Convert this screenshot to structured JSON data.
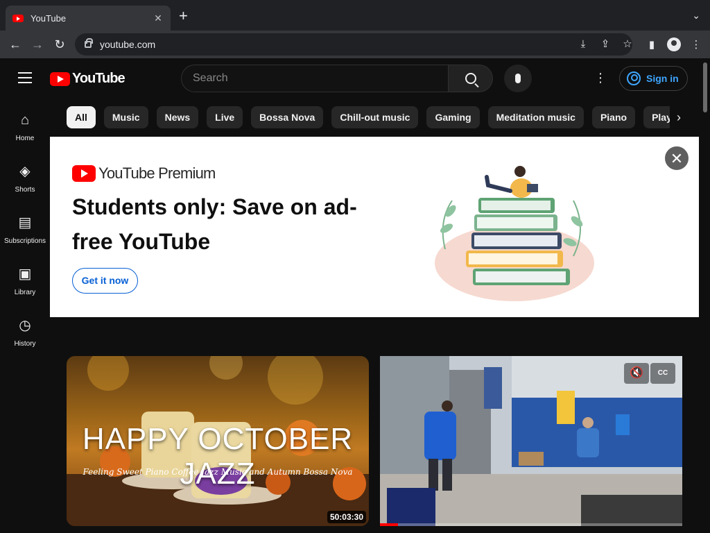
{
  "browser": {
    "tab_title": "YouTube",
    "tab_close": "✕",
    "new_tab": "+",
    "tab_menu": "⌄",
    "url": "youtube.com",
    "back": "←",
    "forward": "→",
    "reload": "↻",
    "actions": [
      "⤓",
      "⇪",
      "☆"
    ],
    "side_panel": "▮",
    "menu": "⋮"
  },
  "header": {
    "logo_text": "YouTube",
    "search_placeholder": "Search",
    "more": "⋮",
    "sign_in": "Sign in"
  },
  "sidebar": {
    "items": [
      {
        "label": "Home",
        "icon": "⌂"
      },
      {
        "label": "Shorts",
        "icon": "◈"
      },
      {
        "label": "Subscriptions",
        "icon": "▤"
      },
      {
        "label": "Library",
        "icon": "▣"
      },
      {
        "label": "History",
        "icon": "◷"
      }
    ]
  },
  "chips": {
    "items": [
      "All",
      "Music",
      "News",
      "Live",
      "Bossa Nova",
      "Chill-out music",
      "Gaming",
      "Meditation music",
      "Piano",
      "Playli"
    ],
    "next": "›"
  },
  "banner": {
    "brand": "YouTube Premium",
    "headline": "Students only: Save on ad-free YouTube",
    "cta": "Get it now",
    "close": "✕"
  },
  "videos": [
    {
      "thumb_title": "HAPPY OCTOBER JAZZ",
      "thumb_subtitle": "Feeling Sweet Piano Coffee Jazz Music and Autumn Bossa Nova",
      "duration": "50:03:30"
    },
    {
      "mute_icon": "🔇",
      "cc_label": "CC",
      "progress_fraction": 0.06
    }
  ],
  "colors": {
    "brand_red": "#ff0000",
    "link_blue": "#3ea6ff",
    "cta_blue": "#065fd4"
  }
}
